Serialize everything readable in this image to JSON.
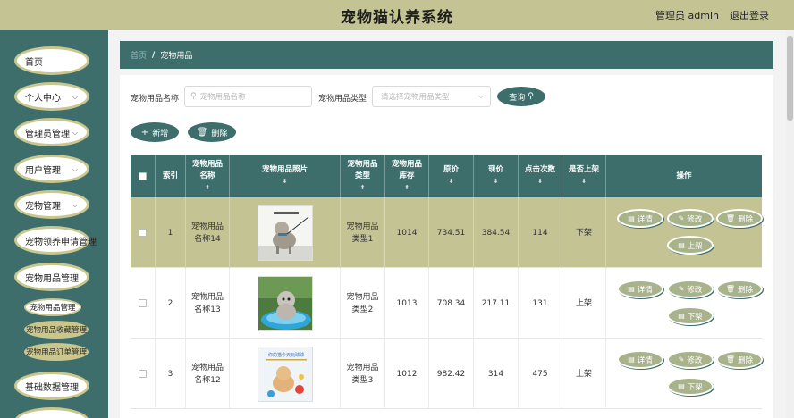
{
  "header": {
    "title": "宠物猫认养系统",
    "user": "管理员 admin",
    "logout": "退出登录"
  },
  "sidebar": {
    "items": [
      {
        "label": "首页",
        "chevron": false
      },
      {
        "label": "个人中心",
        "chevron": true
      },
      {
        "label": "管理员管理",
        "chevron": true
      },
      {
        "label": "用户管理",
        "chevron": true
      },
      {
        "label": "宠物管理",
        "chevron": true
      },
      {
        "label": "宠物领养申请管理",
        "chevron": false
      },
      {
        "label": "宠物用品管理",
        "chevron": false
      },
      {
        "label": "基础数据管理",
        "chevron": false
      }
    ],
    "subitems": [
      "宠物用品管理",
      "宠物用品收藏管理",
      "宠物用品订单管理"
    ]
  },
  "breadcrumb": {
    "home": "首页",
    "separator": "/",
    "current": "宠物用品"
  },
  "search": {
    "name_label": "宠物用品名称",
    "name_placeholder": "宠物用品名称",
    "type_label": "宠物用品类型",
    "type_placeholder": "请选择宠物用品类型",
    "query_button": "查询"
  },
  "toolbar": {
    "add_button": "新增",
    "delete_button": "删除"
  },
  "table": {
    "headers": [
      "索引",
      "宠物用品名称",
      "宠物用品照片",
      "宠物用品类型",
      "宠物用品库存",
      "原价",
      "现价",
      "点击次数",
      "是否上架",
      "操作"
    ],
    "rows": [
      {
        "index": "1",
        "name": "宠物用品名称14",
        "type": "宠物用品类型1",
        "stock": "1014",
        "original": "734.51",
        "current": "384.54",
        "clicks": "114",
        "status": "下架",
        "toggle": "上架",
        "image_text": ""
      },
      {
        "index": "2",
        "name": "宠物用品名称13",
        "type": "宠物用品类型2",
        "stock": "1013",
        "original": "708.34",
        "current": "217.11",
        "clicks": "131",
        "status": "上架",
        "toggle": "下架",
        "image_text": ""
      },
      {
        "index": "3",
        "name": "宠物用品名称12",
        "type": "宠物用品类型3",
        "stock": "1012",
        "original": "982.42",
        "current": "314",
        "clicks": "475",
        "status": "上架",
        "toggle": "下架",
        "image_text": "你的猫今天玩球球"
      }
    ],
    "actions": {
      "detail": "详情",
      "edit": "修改",
      "delete": "删除"
    }
  },
  "colors": {
    "header": "#c4c393",
    "sidebar": "#3d6e6c",
    "accent": "#3d6e6c",
    "highlight_row": "#c4c393",
    "action_button": "#a8b38b"
  }
}
